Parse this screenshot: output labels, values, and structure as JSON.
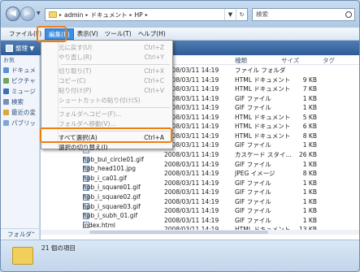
{
  "nav": {
    "back_glyph": "◀",
    "forward_glyph": "▶",
    "recent_glyph": "▼"
  },
  "address": {
    "crumbs": [
      "admin",
      "ドキュメント",
      "HP"
    ],
    "separator": "▸"
  },
  "search": {
    "placeholder": "検索"
  },
  "menubar": {
    "items": [
      "ファイル(F)",
      "編集(E)",
      "表示(V)",
      "ツール(T)",
      "ヘルプ(H)"
    ],
    "active_index": 1
  },
  "toolbar": {
    "organize_label": "整理 ▼"
  },
  "leftpane": {
    "header": "お気",
    "items": [
      {
        "label": "ドキュメ",
        "icon": "documents-icon",
        "color": "#5b8fd6"
      },
      {
        "label": "ピクチャ",
        "icon": "pictures-icon",
        "color": "#6fa55d"
      },
      {
        "label": "ミュージ",
        "icon": "music-icon",
        "color": "#3c6fb8"
      },
      {
        "label": "検索",
        "icon": "search-folder-icon",
        "color": "#7a8fb0"
      },
      {
        "label": "最近の変",
        "icon": "recent-icon",
        "color": "#d6a93c"
      },
      {
        "label": "パブリッ",
        "icon": "public-icon",
        "color": "#7fa6d6"
      }
    ],
    "folders_label": "フォルダ",
    "folders_arrow": "⌃"
  },
  "list": {
    "columns": [
      "種類",
      "サイズ",
      "タグ"
    ],
    "rows": [
      {
        "name": "",
        "date": "2008/03/11 14:19",
        "type": "ファイル フォルダ",
        "size": "",
        "icon": "folder"
      },
      {
        "name": "",
        "date": "2008/03/11 14:19",
        "type": "HTML ドキュメント",
        "size": "9 KB",
        "icon": "html"
      },
      {
        "name": "",
        "date": "2008/03/11 14:19",
        "type": "HTML ドキュメント",
        "size": "7 KB",
        "icon": "html"
      },
      {
        "name": "",
        "date": "2008/03/11 14:19",
        "type": "GIF ファイル",
        "size": "1 KB",
        "icon": "gif"
      },
      {
        "name": "",
        "date": "2008/03/11 14:19",
        "type": "GIF ファイル",
        "size": "1 KB",
        "icon": "gif"
      },
      {
        "name": "",
        "date": "2008/03/11 14:19",
        "type": "HTML ドキュメント",
        "size": "5 KB",
        "icon": "html"
      },
      {
        "name": "",
        "date": "2008/03/11 14:19",
        "type": "HTML ドキュメント",
        "size": "6 KB",
        "icon": "html"
      },
      {
        "name": "",
        "date": "2008/03/11 14:19",
        "type": "HTML ドキュメント",
        "size": "8 KB",
        "icon": "html"
      },
      {
        "name": "",
        "date": "2008/03/11 14:19",
        "type": "GIF ファイル",
        "size": "1 KB",
        "icon": "gif"
      },
      {
        "name": "",
        "date": "2008/03/11 14:19",
        "type": "カスケード スタイ...",
        "size": "26 KB",
        "icon": "css"
      },
      {
        "name": "hpb_bul_circle01.gif",
        "date": "2008/03/11 14:19",
        "type": "GIF ファイル",
        "size": "1 KB",
        "icon": "gif"
      },
      {
        "name": "hpb_head101.jpg",
        "date": "2008/03/11 14:19",
        "type": "JPEG イメージ",
        "size": "8 KB",
        "icon": "jpg"
      },
      {
        "name": "hpb_i_ca01.gif",
        "date": "2008/03/11 14:19",
        "type": "GIF ファイル",
        "size": "1 KB",
        "icon": "gif"
      },
      {
        "name": "hpb_i_square01.gif",
        "date": "2008/03/11 14:19",
        "type": "GIF ファイル",
        "size": "1 KB",
        "icon": "gif"
      },
      {
        "name": "hpb_i_square02.gif",
        "date": "2008/03/11 14:19",
        "type": "GIF ファイル",
        "size": "1 KB",
        "icon": "gif"
      },
      {
        "name": "hpb_i_square03.gif",
        "date": "2008/03/11 14:19",
        "type": "GIF ファイル",
        "size": "1 KB",
        "icon": "gif"
      },
      {
        "name": "hpb_i_subh_01.gif",
        "date": "2008/03/11 14:19",
        "type": "GIF ファイル",
        "size": "1 KB",
        "icon": "gif"
      },
      {
        "name": "index.html",
        "date": "2008/03/11 14:19",
        "type": "HTML ドキュメント",
        "size": "13 KB",
        "icon": "html"
      }
    ]
  },
  "dropdown": {
    "items": [
      {
        "label": "元に戻す(U)",
        "shortcut": "Ctrl+Z",
        "disabled": true
      },
      {
        "label": "やり直し(R)",
        "shortcut": "Ctrl+Y",
        "disabled": true
      },
      {
        "sep": true
      },
      {
        "label": "切り取り(T)",
        "shortcut": "Ctrl+X",
        "disabled": true
      },
      {
        "label": "コピー(C)",
        "shortcut": "Ctrl+C",
        "disabled": true
      },
      {
        "label": "貼り付け(P)",
        "shortcut": "Ctrl+V",
        "disabled": true
      },
      {
        "label": "ショートカットの貼り付け(S)",
        "shortcut": "",
        "disabled": true
      },
      {
        "sep": true
      },
      {
        "label": "フォルダへコピー(F)...",
        "shortcut": "",
        "disabled": true
      },
      {
        "label": "フォルダへ移動(V)...",
        "shortcut": "",
        "disabled": true
      },
      {
        "sep": true
      },
      {
        "label": "すべて選択(A)",
        "shortcut": "Ctrl+A",
        "disabled": false,
        "highlighted": true
      },
      {
        "label": "選択の切り替え(I)",
        "shortcut": "",
        "disabled": false
      }
    ]
  },
  "details": {
    "item_count": "21 個の項目"
  },
  "colors": {
    "highlight": "#f07d10",
    "menu_active": "#3d8de0",
    "toolbar": "#2f5c95"
  }
}
